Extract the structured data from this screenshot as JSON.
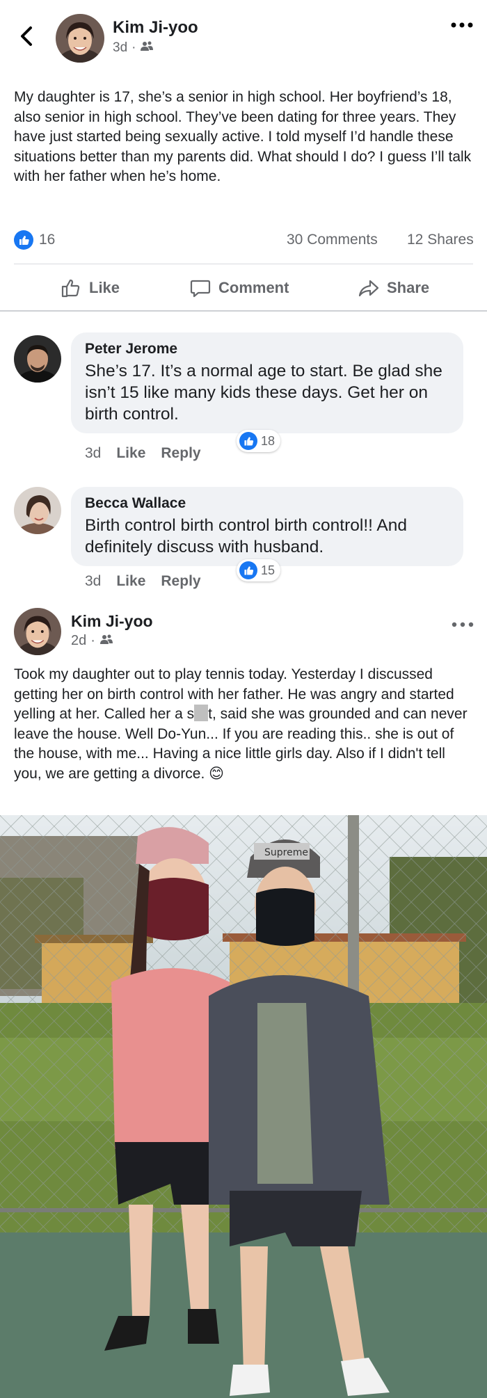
{
  "header": {
    "author": "Kim Ji-yoo",
    "time": "3d",
    "audience_icon": "friends-icon"
  },
  "post": {
    "text": "My daughter is 17, she’s a senior in high school. Her boyfriend’s 18, also senior in high school. They’ve been dating for three years. They have just started being sexually active. I told myself I’d handle these situations better than my parents did. What should I do? I guess I’ll talk with her father when he’s home.",
    "like_count": "16",
    "comments": "30 Comments",
    "shares": "12 Shares"
  },
  "actions": {
    "like": "Like",
    "comment": "Comment",
    "share": "Share"
  },
  "comments": [
    {
      "name": "Peter Jerome",
      "text": "She’s 17. It’s a normal age to start. Be glad she isn’t 15 like many kids these days. Get her on birth control.",
      "time": "3d",
      "like": "Like",
      "reply": "Reply",
      "reactions": "18"
    },
    {
      "name": "Becca Wallace",
      "text": "Birth control birth control birth control!! And definitely discuss with husband.",
      "time": "3d",
      "like": "Like",
      "reply": "Reply",
      "reactions": "15"
    }
  ],
  "post2": {
    "author": "Kim Ji-yoo",
    "time": "2d",
    "text_before": "Took my daughter out to play tennis today. Yesterday I discussed getting her on birth control with her father. He was angry and started yelling at her. Called her a s",
    "text_after": "t, said she was grounded and can never leave the house. Well Do-Yun... If you are reading this.. she is out of the house, with me... Having a nice little girls day. Also if I didn't tell you, we are getting a divorce.",
    "emoji": "😊"
  },
  "photo": {
    "cap_text": "Supreme"
  },
  "colors": {
    "like_blue": "#1877f2",
    "muted": "#65676b",
    "bubble": "#f0f2f5"
  }
}
